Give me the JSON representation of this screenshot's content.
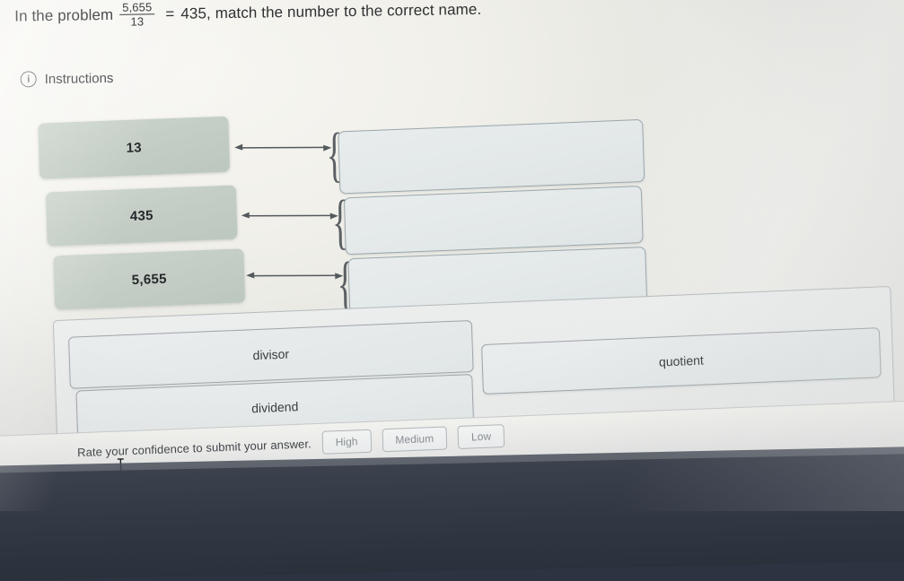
{
  "prompt": {
    "lead": "In the problem",
    "fraction": {
      "numerator": "5,655",
      "denominator": "13"
    },
    "equals": "=",
    "result": "435",
    "tail": ", match the number to the correct name."
  },
  "instructions": {
    "icon": "info-circle-icon",
    "label": "Instructions"
  },
  "numbers": [
    {
      "value": "13"
    },
    {
      "value": "435"
    },
    {
      "value": "5,655"
    }
  ],
  "drop_targets": [
    {
      "value": ""
    },
    {
      "value": ""
    },
    {
      "value": ""
    }
  ],
  "options": [
    {
      "label": "divisor"
    },
    {
      "label": "dividend"
    },
    {
      "label": "quotient"
    }
  ],
  "confidence": {
    "label": "Rate your confidence to submit your answer.",
    "buttons": [
      "High",
      "Medium",
      "Low"
    ]
  },
  "colors": {
    "page_background": "#f1f0ea",
    "tile_fill": "#c4cec6",
    "drop_border": "#9aa7ac",
    "option_fill": "#e5e9ea",
    "text": "#2f3133",
    "desk": "#333945"
  }
}
